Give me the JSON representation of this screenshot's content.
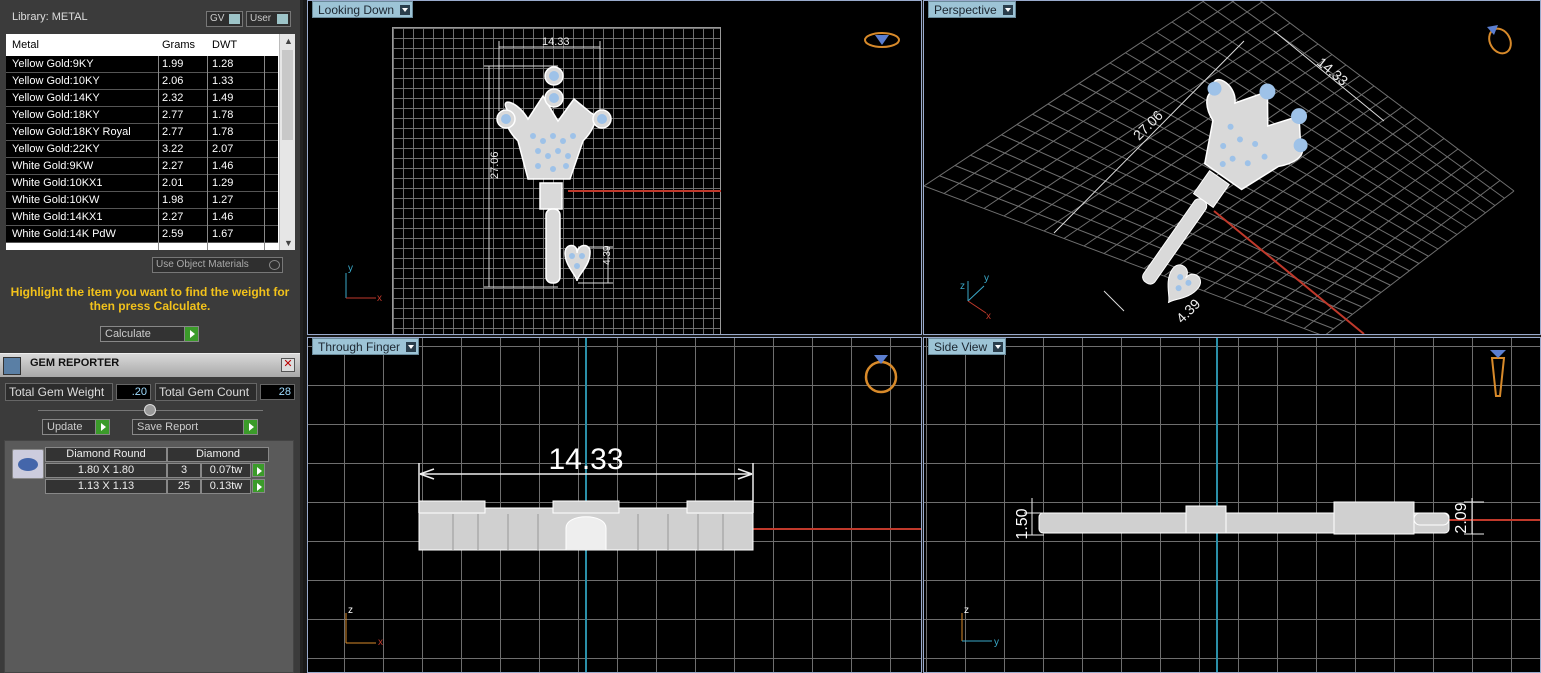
{
  "library": {
    "title": "Library: METAL",
    "toggles": [
      "GV",
      "User"
    ],
    "columns": [
      "Metal",
      "Grams",
      "DWT"
    ],
    "rows": [
      [
        "Yellow Gold:9KY",
        "1.99",
        "1.28"
      ],
      [
        "Yellow Gold:10KY",
        "2.06",
        "1.33"
      ],
      [
        "Yellow Gold:14KY",
        "2.32",
        "1.49"
      ],
      [
        "Yellow Gold:18KY",
        "2.77",
        "1.78"
      ],
      [
        "Yellow Gold:18KY Royal",
        "2.77",
        "1.78"
      ],
      [
        "Yellow Gold:22KY",
        "3.22",
        "2.07"
      ],
      [
        "White Gold:9KW",
        "2.27",
        "1.46"
      ],
      [
        "White Gold:10KX1",
        "2.01",
        "1.29"
      ],
      [
        "White Gold:10KW",
        "1.98",
        "1.27"
      ],
      [
        "White Gold:14KX1",
        "2.27",
        "1.46"
      ],
      [
        "White Gold:14K PdW",
        "2.59",
        "1.67"
      ]
    ],
    "use_object_materials": "Use Object Materials",
    "hint": "Highlight the item you want to find the weight for then press Calculate.",
    "calculate_label": "Calculate"
  },
  "gem_reporter": {
    "title": "GEM REPORTER",
    "total_weight_label": "Total Gem Weight",
    "total_weight_value": ".20",
    "total_count_label": "Total Gem Count",
    "total_count_value": "28",
    "update_label": "Update",
    "save_report_label": "Save Report",
    "gem_shape": "Diamond Round",
    "gem_type": "Diamond",
    "gems": [
      {
        "size": "1.80 X 1.80",
        "count": "3",
        "weight": "0.07tw"
      },
      {
        "size": "1.13 X 1.13",
        "count": "25",
        "weight": "0.13tw"
      }
    ]
  },
  "viewports": {
    "top": {
      "label": "Looking Down",
      "width_dim": "14.33",
      "height_dim": "27.06",
      "heart_dim": "4.39",
      "axes": [
        "y",
        "x"
      ]
    },
    "perspective": {
      "label": "Perspective",
      "width_dim": "14.33",
      "height_dim": "27.06",
      "heart_dim": "4.39",
      "axes": [
        "z",
        "y",
        "x"
      ]
    },
    "front": {
      "label": "Through Finger",
      "width_dim": "14.33",
      "axes": [
        "z",
        "x"
      ]
    },
    "side": {
      "label": "Side View",
      "left_dim": "1.50",
      "right_dim": "2.09",
      "axes": [
        "z",
        "y"
      ]
    }
  },
  "colors": {
    "accent_green": "#3b9b2a",
    "hint_yellow": "#f2c21b",
    "tab_blue": "#9dc4d6",
    "gem_blue": "#a9c8ec",
    "axis_red": "#c0392b"
  }
}
